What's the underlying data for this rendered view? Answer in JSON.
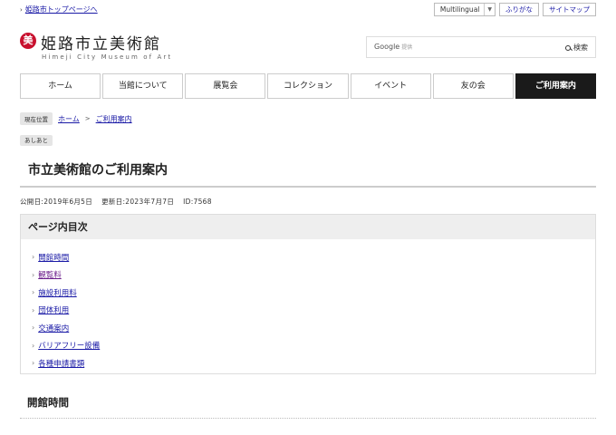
{
  "topbar": {
    "home_link": "姫路市トップページへ",
    "buttons": {
      "multilingual": "Multilingual",
      "furigana": "ふりがな",
      "sitemap": "サイトマップ"
    }
  },
  "logo": {
    "mark": "美",
    "title": "姫路市立美術館",
    "subtitle": "Himeji City Museum of Art"
  },
  "search": {
    "brand": "Google",
    "brand_sub": "提供",
    "button_label": "検索"
  },
  "nav": {
    "items": [
      {
        "label": "ホーム"
      },
      {
        "label": "当館について"
      },
      {
        "label": "展覧会"
      },
      {
        "label": "コレクション"
      },
      {
        "label": "イベント"
      },
      {
        "label": "友の会"
      },
      {
        "label": "ご利用案内",
        "active": true
      }
    ]
  },
  "breadcrumb": {
    "current_label": "現在位置",
    "items": [
      "ホーム",
      "ご利用案内"
    ],
    "footprint_label": "あしあと"
  },
  "page": {
    "title": "市立美術館のご利用案内",
    "published": "公開日:2019年6月5日",
    "updated": "更新日:2023年7月7日",
    "id": "ID:7568"
  },
  "toc": {
    "heading": "ページ内目次",
    "items": [
      "開館時間",
      "観覧料",
      "施設利用料",
      "団体利用",
      "交通案内",
      "バリアフリー設備",
      "各種申請書類"
    ]
  },
  "section": {
    "heading": "開館時間"
  },
  "colors": {
    "logo_red": "#c8102e",
    "nav_active": "#1a1a1a",
    "link": "#1a1aa6",
    "visited": "#6a1b8a"
  }
}
